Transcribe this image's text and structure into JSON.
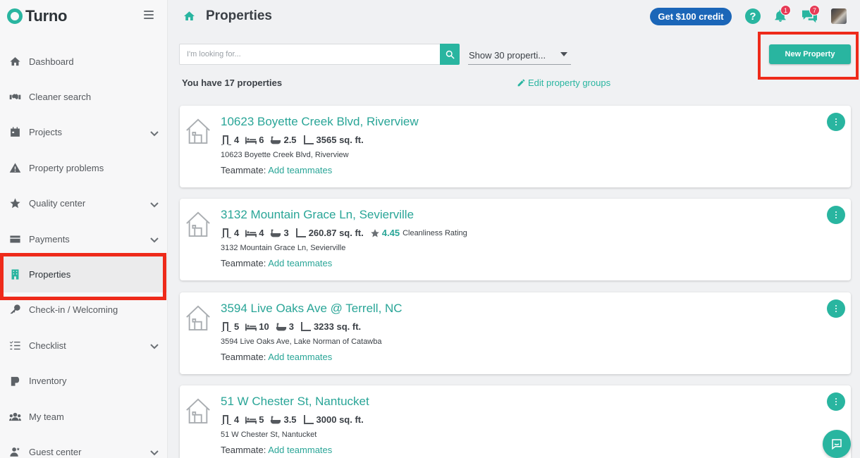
{
  "app": {
    "logo_text": "Turno"
  },
  "sidebar": {
    "items": [
      {
        "label": "Dashboard",
        "icon": "home-icon",
        "has_chevron": false
      },
      {
        "label": "Cleaner search",
        "icon": "handshake-icon",
        "has_chevron": false
      },
      {
        "label": "Projects",
        "icon": "calendar-icon",
        "has_chevron": true
      },
      {
        "label": "Property problems",
        "icon": "warning-icon",
        "has_chevron": false
      },
      {
        "label": "Quality center",
        "icon": "star-icon",
        "has_chevron": true
      },
      {
        "label": "Payments",
        "icon": "credit-card-icon",
        "has_chevron": true
      },
      {
        "label": "Properties",
        "icon": "building-icon",
        "has_chevron": false,
        "active": true
      },
      {
        "label": "Check-in / Welcoming",
        "icon": "key-icon",
        "has_chevron": false
      },
      {
        "label": "Checklist",
        "icon": "checklist-icon",
        "has_chevron": true
      },
      {
        "label": "Inventory",
        "icon": "toilet-paper-icon",
        "has_chevron": false
      },
      {
        "label": "My team",
        "icon": "users-icon",
        "has_chevron": false
      },
      {
        "label": "Guest center",
        "icon": "guest-icon",
        "has_chevron": true
      }
    ]
  },
  "header": {
    "title": "Properties",
    "credit_button": "Get $100 credit",
    "help_label": "?",
    "notifications_count": "1",
    "messages_count": "7"
  },
  "toolbar": {
    "search_placeholder": "I'm looking for...",
    "show_select_value": "Show 30 properti...",
    "new_property_label": "New Property"
  },
  "summary": {
    "count_text": "You have 17 properties",
    "edit_groups_label": "Edit property groups"
  },
  "properties": [
    {
      "title": "10623 Boyette Creek Blvd, Riverview",
      "doors": "4",
      "beds": "6",
      "baths": "2.5",
      "area": "3565 sq. ft.",
      "address": "10623 Boyette Creek Blvd, Riverview",
      "teammate_label": "Teammate:",
      "teammate_link": "Add teammates"
    },
    {
      "title": "3132 Mountain Grace Ln, Sevierville",
      "doors": "4",
      "beds": "4",
      "baths": "3",
      "area": "260.87 sq. ft.",
      "rating": "4.45",
      "rating_label": "Cleanliness Rating",
      "address": "3132 Mountain Grace Ln, Sevierville",
      "teammate_label": "Teammate:",
      "teammate_link": "Add teammates"
    },
    {
      "title": "3594 Live Oaks Ave @ Terrell, NC",
      "doors": "5",
      "beds": "10",
      "baths": "3",
      "area": "3233 sq. ft.",
      "address": "3594 Live Oaks Ave, Lake Norman of Catawba",
      "teammate_label": "Teammate:",
      "teammate_link": "Add teammates"
    },
    {
      "title": "51 W Chester St, Nantucket",
      "doors": "4",
      "beds": "5",
      "baths": "3.5",
      "area": "3000 sq. ft.",
      "address": "51 W Chester St, Nantucket",
      "teammate_label": "Teammate:",
      "teammate_link": "Add teammates"
    }
  ],
  "colors": {
    "accent": "#29b5a0",
    "link": "#29a597",
    "credit_button": "#1b66b8",
    "badge": "#e63b56",
    "highlight_box": "#ee2a1a"
  }
}
